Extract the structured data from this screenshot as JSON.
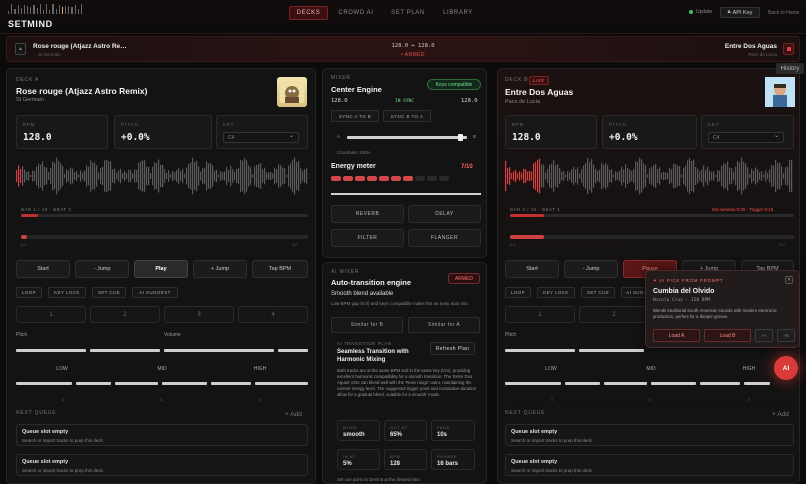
{
  "app": {
    "name": "SETMIND"
  },
  "nav": {
    "tabs": [
      {
        "label": "DECKS",
        "active": true
      },
      {
        "label": "CROWD AI",
        "active": false
      },
      {
        "label": "SET PLAN",
        "active": false
      },
      {
        "label": "LIBRARY",
        "active": false
      }
    ],
    "updates": "Update",
    "api_key": "API Key",
    "back_home": "Back to Home"
  },
  "strip": {
    "left_title": "Rose rouge (Atjazz Astro Re…",
    "left_sub": "St Germain",
    "bpm_text": "128.0 ↔ 128.0",
    "status": "• ARMED",
    "right_title": "Entre Dos Aguas",
    "right_sub": "Paco de Lucía"
  },
  "history_label": "History",
  "deck_a": {
    "tag": "DECK A",
    "title": "Rose rouge (Atjazz Astro Remix)",
    "artist": "St Germain",
    "bpm_label": "BPM",
    "bpm": "128.0",
    "pitch_label": "PITCH",
    "pitch": "+0.0%",
    "key_label": "KEY",
    "key_value": "C4",
    "bar_beat": "BAR 1 / 16 · BEAT 2",
    "bar_progress": 0.06,
    "position": 0.02,
    "pos_start": "0:0",
    "pos_end": "3:0",
    "transport": [
      "Start",
      "- Jump",
      "Play",
      "+ Jump",
      "Tap BPM"
    ],
    "tools": [
      "LOOP",
      "KEY LOCK",
      "SET CUE",
      "AI SUGGEST"
    ],
    "cues": [
      "1",
      "2",
      "3",
      "4"
    ],
    "pitch_text": "Pitch",
    "volume_text": "Volume",
    "eq": [
      "LOW",
      "MID",
      "HIGH"
    ],
    "eq_vals": [
      "0",
      "0",
      "0"
    ],
    "queue_label": "NEXT QUEUE",
    "queue_add": "+ Add",
    "queue": [
      {
        "title": "Queue slot empty",
        "sub": "Search or import tracks to prep this deck."
      },
      {
        "title": "Queue slot empty",
        "sub": "Search or import tracks to prep this deck."
      }
    ]
  },
  "mixer": {
    "tag": "MIXER",
    "title": "Center Engine",
    "badge": "Keys compatible",
    "bpm_a": "128.0",
    "sync_status": "IN SYNC",
    "bpm_b": "128.0",
    "sync_a": "SYNC A TO B",
    "sync_b": "SYNC B TO A",
    "xf_a": "A",
    "xf_b": "B",
    "crossfader": 0.95,
    "crossfader_text": "Crossfader 100%",
    "energy_label": "Energy meter",
    "energy_value": "7/10",
    "energy_level": 7,
    "energy_max": 10,
    "fx": [
      "REVERB",
      "DELAY",
      "FILTER",
      "FLANGER"
    ]
  },
  "auto": {
    "tag": "AI MIXER",
    "title": "Auto-transition engine",
    "armed": "ARMED",
    "headline": "Smooth blend available",
    "desc": "Low BPM gap (0.0) and keys compatible make this an easy auto mix.",
    "similar_b": "Similar for B",
    "similar_a": "Similar for A",
    "plan_tag": "AI TRANSITION PLAN",
    "plan_title": "Seamless Transition with Harmonic Mixing",
    "refresh": "Refresh Plan",
    "plan_body": "Both tracks are at the same BPM and in the same key (Cm), providing excellent harmonic compatibility for a smooth transition. The 'Entre Dos Aguas' intro can blend well with the 'Rose rouge' outro, maintaining the current energy level. The suggested trigger point and cumulative duration allow for a gradual blend, suitable for a smooth' mode.",
    "cells": [
      {
        "k": "MODE",
        "v": "smooth"
      },
      {
        "k": "OUT AT",
        "v": "65%"
      },
      {
        "k": "FADE",
        "v": "10s"
      },
      {
        "k": "IN AT",
        "v": "5%"
      },
      {
        "k": "BPM",
        "v": "128"
      },
      {
        "k": "PHRASE",
        "v": "16 bars"
      }
    ],
    "footer": "Set cue point on Deck B at the desired intro"
  },
  "deck_b": {
    "tag": "DECK B",
    "live": "LIVE",
    "title": "Entre Dos Aguas",
    "artist": "Paco de Lucía",
    "bpm_label": "BPM",
    "bpm": "128.0",
    "pitch_label": "PITCH",
    "pitch": "+0.0%",
    "key_label": "KEY",
    "key_value": "C4",
    "bar_beat": "BAR 2 / 16 · BEAT 1",
    "mix_window": "Mix window 0:30 - Trigger 0:15",
    "bar_progress": 0.12,
    "position": 0.12,
    "pos_start": "0:0",
    "pos_end": "3:0",
    "transport": [
      "Start",
      "- Jump",
      "Pause",
      "+ Jump",
      "Tap BPM"
    ],
    "tools": [
      "LOOP",
      "KEY LOCK",
      "SET CUE",
      "AI SUG"
    ],
    "cues": [
      "1",
      "2"
    ],
    "pitch_text": "Pitch",
    "eq": [
      "LOW",
      "MID",
      "HIGH"
    ],
    "eq_vals": [
      "0",
      "0",
      "0"
    ],
    "queue_label": "NEXT QUEUE",
    "queue_add": "+ Add",
    "queue": [
      {
        "title": "Queue slot empty",
        "sub": "Search or import tracks to prep this deck."
      },
      {
        "title": "Queue slot empty",
        "sub": "Search or import tracks to prep this deck."
      }
    ]
  },
  "popup": {
    "tag": "AI PICK FROM PROMPT",
    "title": "Cumbia del Olvido",
    "meta": "Nicola Cruz · 120 BPM",
    "desc": "Blends traditional South American sounds with modern electronic production, perfect for a deeper groove.",
    "load_a": "Load A",
    "load_b": "Load B",
    "plus_a": "+A",
    "plus_b": "+B"
  },
  "ai_button": "AI",
  "colors": {
    "accent": "#d93a3a",
    "green": "#70e090",
    "bg": "#0b0b0c"
  }
}
